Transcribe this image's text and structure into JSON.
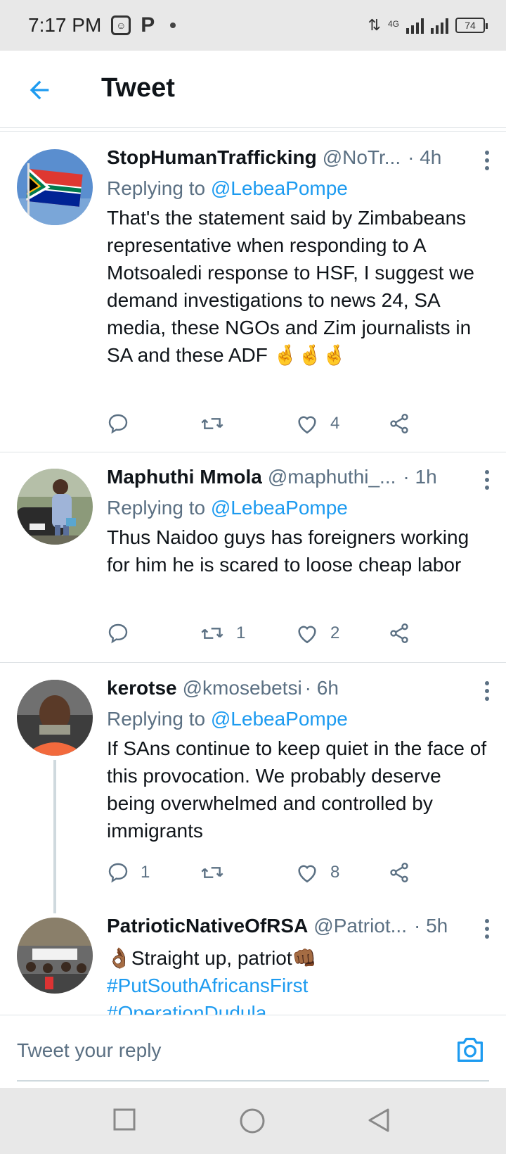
{
  "status_bar": {
    "time": "7:17 PM",
    "network_label": "4G",
    "battery": "74"
  },
  "header": {
    "title": "Tweet"
  },
  "tweets": [
    {
      "name": "StopHumanTrafficking",
      "handle": "@NoTr...",
      "time": "· 4h",
      "replying_prefix": "Replying to ",
      "replying_to": "@LebeaPompe",
      "text": "That's the statement said by Zimbabeans representative when responding to A Motsoaledi response to HSF, I suggest we demand investigations to news 24, SA media, these NGOs and Zim journalists in SA and these ADF 🤞🤞🤞",
      "replies": "",
      "retweets": "",
      "likes": "4"
    },
    {
      "name": "Maphuthi Mmola",
      "handle": "@maphuthi_...",
      "time": "· 1h",
      "replying_prefix": "Replying to ",
      "replying_to": "@LebeaPompe",
      "text": "Thus Naidoo guys has foreigners working for him he is scared to loose cheap labor",
      "replies": "",
      "retweets": "1",
      "likes": "2"
    },
    {
      "name": "kerotse",
      "handle": "@kmosebetsi",
      "time": "· 6h",
      "replying_prefix": "Replying to ",
      "replying_to": "@LebeaPompe",
      "text": "If SAns continue to keep quiet in the face of this provocation. We probably deserve being overwhelmed and controlled by immigrants",
      "replies": "1",
      "retweets": "",
      "likes": "8"
    },
    {
      "name": "PatrioticNativeOfRSA",
      "handle": "@Patriot...",
      "time": "· 5h",
      "text_line1": "👌🏾Straight up, patriot👊🏾",
      "hashtag1": "#PutSouthAfricansFirst",
      "hashtag2": "#OperationDudula"
    }
  ],
  "reply_bar": {
    "placeholder": "Tweet your reply"
  },
  "icons": {
    "back": "arrow-left-icon",
    "more": "more-vertical-icon",
    "reply": "comment-icon",
    "retweet": "retweet-icon",
    "like": "heart-icon",
    "share": "share-icon",
    "camera": "camera-icon"
  },
  "colors": {
    "accent": "#1d9bf0",
    "secondary_text": "#5b7083"
  }
}
